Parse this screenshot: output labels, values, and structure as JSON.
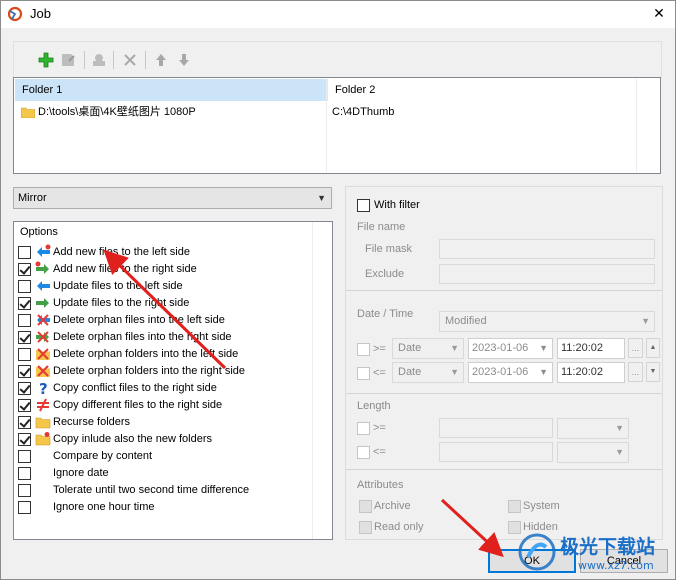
{
  "window": {
    "title": "Job",
    "close_glyph": "✕"
  },
  "toolbar": {
    "buttons": [
      {
        "name": "add-icon",
        "enabled": true
      },
      {
        "name": "edit-icon",
        "enabled": false
      },
      {
        "name": "stamp-icon",
        "enabled": false
      },
      {
        "name": "delete-icon",
        "enabled": false
      },
      {
        "name": "move-up-icon",
        "enabled": false
      },
      {
        "name": "move-down-icon",
        "enabled": false
      }
    ]
  },
  "folders": {
    "header1": "Folder 1",
    "header2": "Folder 2",
    "rows": [
      {
        "folder1": "D:\\tools\\桌面\\4K壁纸图片 1080P",
        "folder2": "C:\\4DThumb"
      }
    ]
  },
  "mode": {
    "value": "Mirror"
  },
  "options": {
    "title": "Options",
    "items": [
      {
        "label": "Add new files to the left side",
        "checked": false,
        "icon": "arrow-left-new-icon"
      },
      {
        "label": "Add new files to the right side",
        "checked": true,
        "icon": "arrow-right-new-icon"
      },
      {
        "label": "Update files to the left side",
        "checked": false,
        "icon": "arrow-left-update-icon"
      },
      {
        "label": "Update files to the right side",
        "checked": true,
        "icon": "arrow-right-update-icon"
      },
      {
        "label": "Delete orphan files into the left side",
        "checked": false,
        "icon": "delete-files-left-icon"
      },
      {
        "label": "Delete orphan files into the right side",
        "checked": true,
        "icon": "delete-files-right-icon"
      },
      {
        "label": "Delete orphan folders into the left side",
        "checked": false,
        "icon": "delete-folders-left-icon"
      },
      {
        "label": "Delete orphan folders into the right side",
        "checked": true,
        "icon": "delete-folders-right-icon"
      },
      {
        "label": "Copy conflict files to the right side",
        "checked": true,
        "icon": "question-icon"
      },
      {
        "label": "Copy different files to the right side",
        "checked": true,
        "icon": "not-equal-icon"
      },
      {
        "label": "Recurse folders",
        "checked": true,
        "icon": "folder-icon"
      },
      {
        "label": "Copy inlude also the new folders",
        "checked": true,
        "icon": "new-folder-icon"
      },
      {
        "label": "Compare by content",
        "checked": false,
        "icon": ""
      },
      {
        "label": "Ignore date",
        "checked": false,
        "icon": ""
      },
      {
        "label": "Tolerate until two second time difference",
        "checked": false,
        "icon": ""
      },
      {
        "label": "Ignore one hour time",
        "checked": false,
        "icon": ""
      }
    ]
  },
  "filter": {
    "with_filter_label": "With filter",
    "file_name_label": "File name",
    "file_mask_label": "File mask",
    "exclude_label": "Exclude",
    "date_time_label": "Date / Time",
    "date_mode_value": "Modified",
    "ge_label": ">=",
    "le_label": "<=",
    "date_label": "Date",
    "date1": "2023-01-06",
    "time1": "11:20:02",
    "date2": "2023-01-06",
    "time2": "11:20:02",
    "ellipsis": "...",
    "length_label": "Length",
    "attributes_label": "Attributes",
    "archive_label": "Archive",
    "system_label": "System",
    "read_only_label": "Read only",
    "hidden_label": "Hidden"
  },
  "buttons": {
    "ok": "OK",
    "cancel": "Cancel"
  },
  "watermark": {
    "line1": "极光下载站",
    "line2": "www.xz7.com"
  },
  "colors": {
    "selection": "#cce4f7",
    "accent": "#0078d7",
    "annotation": "#e0201c",
    "watermark": "#1b6fc6"
  }
}
